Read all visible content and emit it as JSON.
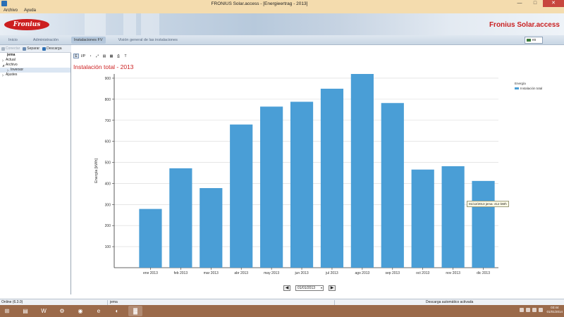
{
  "window": {
    "title": "FRONIUS Solar.access - [Energieertrag - 2013]",
    "minimize": "—",
    "maximize": "□",
    "close": "✕"
  },
  "menu": [
    {
      "label": "Archivo"
    },
    {
      "label": "Ayuda"
    }
  ],
  "banner": {
    "logo": "Fronius",
    "brand": "Fronius Solar.access"
  },
  "nav": {
    "tabs": [
      {
        "label": "Inicio",
        "active": false
      },
      {
        "label": "Administración",
        "active": false
      },
      {
        "label": "Instalaciones FV",
        "active": true
      },
      {
        "label": "Visión general de las instalaciones",
        "active": false
      }
    ],
    "language": "es"
  },
  "left_toolbar": {
    "connect": "Conectar",
    "disconnect": "Separar",
    "download": "Descarga"
  },
  "tree": {
    "root": "jema",
    "items": [
      {
        "label": "Actual",
        "toggle": "▷",
        "level": 1
      },
      {
        "label": "Archivo",
        "toggle": "◢",
        "level": 1
      },
      {
        "label": "Inversor",
        "toggle": "▷",
        "level": 2,
        "selected": true
      },
      {
        "label": "Ajustes",
        "toggle": "▷",
        "level": 1
      }
    ]
  },
  "chart_toolbar": [
    "E",
    "I/P",
    "◔",
    "⤢",
    "▤",
    "▦",
    "⎙",
    "T"
  ],
  "chart_title": "Instalación total - 2013",
  "chart_data": {
    "type": "bar",
    "title": "Instalación total - 2013",
    "xlabel": "",
    "ylabel": "Energía [kWh]",
    "categories": [
      "ene 2013",
      "feb 2013",
      "mar 2013",
      "abr 2013",
      "may 2013",
      "jun 2013",
      "jul 2013",
      "ago 2013",
      "sep 2013",
      "oct 2013",
      "nov 2013",
      "dic 2013"
    ],
    "series": [
      {
        "name": "Instalación total",
        "values": [
          279,
          472,
          378,
          680,
          765,
          788,
          850,
          920,
          782,
          466,
          482,
          412
        ]
      }
    ],
    "ylim": [
      0,
      920
    ],
    "yticks": [
      100,
      200,
      300,
      400,
      500,
      600,
      700,
      800,
      900
    ],
    "grid": true,
    "legend_title": "Energía",
    "legend_position": "right",
    "color": "#4a9ed6"
  },
  "tooltip": "01/12/2013 jema: 412 kWh",
  "date_nav": {
    "prev": "◀",
    "next": "▶",
    "date": "01/01/2013",
    "dropdown": "▾"
  },
  "status": {
    "online": "Online (6.3.0)",
    "user": "jema",
    "message": "Descarga automático activada"
  },
  "taskbar": {
    "items": [
      {
        "icon": "windows-start-icon",
        "glyph": "⊞"
      },
      {
        "icon": "file-explorer-icon",
        "glyph": "▤"
      },
      {
        "icon": "word-icon",
        "glyph": "W"
      },
      {
        "icon": "settings-icon",
        "glyph": "⚙"
      },
      {
        "icon": "chrome-icon",
        "glyph": "◉"
      },
      {
        "icon": "internet-explorer-icon",
        "glyph": "e"
      },
      {
        "icon": "media-player-icon",
        "glyph": "◐"
      },
      {
        "icon": "solar-access-icon",
        "glyph": "▓",
        "active": true
      }
    ],
    "time": "03:44",
    "date": "01/01/2014"
  }
}
